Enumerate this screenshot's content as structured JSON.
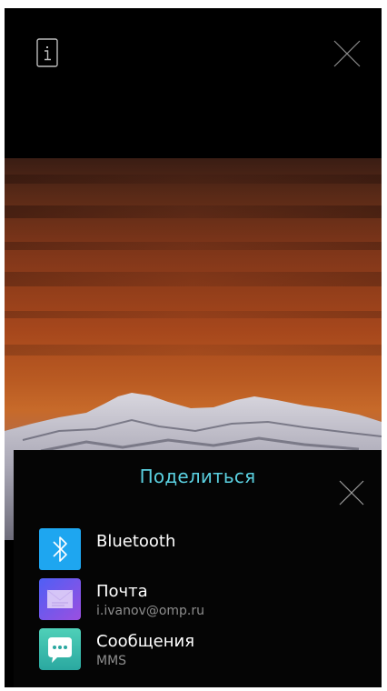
{
  "header": {
    "info_icon": "info-icon",
    "close_icon": "close-icon"
  },
  "share": {
    "title": "Поделиться",
    "close_icon": "close-icon",
    "items": [
      {
        "label": "Bluetooth",
        "subtitle": "",
        "icon": "bluetooth-icon",
        "color": "#1ea6f0"
      },
      {
        "label": "Почта",
        "subtitle": "i.ivanov@omp.ru",
        "icon": "mail-icon",
        "color": "#6a5cf0"
      },
      {
        "label": "Сообщения",
        "subtitle": "MMS",
        "icon": "message-icon",
        "color": "#3cc0b0"
      }
    ]
  },
  "colors": {
    "accent": "#5ad0e0",
    "background": "#000000"
  }
}
